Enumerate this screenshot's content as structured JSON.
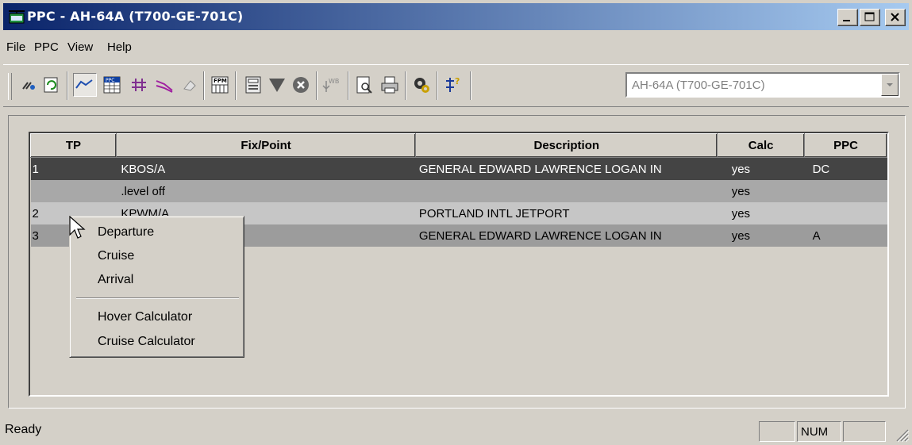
{
  "window": {
    "title": "PPC - AH-64A (T700-GE-701C)"
  },
  "menu": [
    "File",
    "PPC",
    "View",
    "Help"
  ],
  "toolbar": {
    "icons": [
      "tools-icon",
      "refresh-icon",
      "route-icon",
      "ppc-table-icon",
      "grid-icon",
      "flight-path-icon",
      "erase-icon",
      "fpm-icon",
      "calculator-icon",
      "filter-icon",
      "cancel-icon",
      "wb-icon",
      "print-preview-icon",
      "print-icon",
      "settings-gear-icon",
      "help-context-icon"
    ],
    "fpm_label": "FPM",
    "ppc_label": "PPC",
    "wb_label": "WB",
    "aircraft_select": "AH-64A (T700-GE-701C)"
  },
  "grid": {
    "headers": [
      "TP",
      "Fix/Point",
      "Description",
      "Calc",
      "PPC"
    ],
    "rows": [
      {
        "tp": "1",
        "fix": "KBOS/A",
        "desc": "GENERAL EDWARD LAWRENCE LOGAN IN",
        "calc": "yes",
        "ppc": "DC"
      },
      {
        "tp": "",
        "fix": ".level off",
        "desc": "",
        "calc": "yes",
        "ppc": ""
      },
      {
        "tp": "2",
        "fix": "KPWM/A",
        "desc": "PORTLAND INTL JETPORT",
        "calc": "yes",
        "ppc": ""
      },
      {
        "tp": "3",
        "fix": "",
        "desc": "GENERAL EDWARD LAWRENCE LOGAN IN",
        "calc": "yes",
        "ppc": "A"
      }
    ]
  },
  "context_menu": {
    "items": [
      "Departure",
      "Cruise",
      "Arrival",
      "Hover Calculator",
      "Cruise Calculator"
    ]
  },
  "statusbar": {
    "text": "Ready",
    "num": "NUM"
  },
  "colors": {
    "title_start": "#0a246a",
    "title_end": "#a6caf0",
    "selected_row": "#444444",
    "face": "#d4d0c8"
  }
}
